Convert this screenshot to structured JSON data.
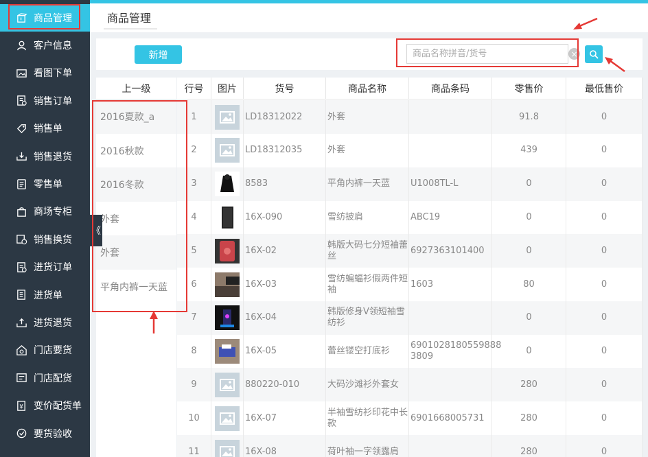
{
  "colors": {
    "accent": "#34c4e4",
    "sidebar": "#2c3844",
    "annotation": "#e53935"
  },
  "sidebar": {
    "items": [
      {
        "label": "商品管理",
        "icon": "box-icon"
      },
      {
        "label": "客户信息",
        "icon": "user-icon"
      },
      {
        "label": "看图下单",
        "icon": "image-order-icon"
      },
      {
        "label": "销售订单",
        "icon": "order-list-icon"
      },
      {
        "label": "销售单",
        "icon": "tag-icon"
      },
      {
        "label": "销售退货",
        "icon": "return-tray-icon"
      },
      {
        "label": "零售单",
        "icon": "receipt-icon"
      },
      {
        "label": "商场专柜",
        "icon": "shopping-bag-icon"
      },
      {
        "label": "销售换货",
        "icon": "exchange-icon"
      },
      {
        "label": "进货订单",
        "icon": "purchase-order-icon"
      },
      {
        "label": "进货单",
        "icon": "purchase-sheet-icon"
      },
      {
        "label": "进货退货",
        "icon": "purchase-return-icon"
      },
      {
        "label": "门店要货",
        "icon": "store-request-icon"
      },
      {
        "label": "门店配货",
        "icon": "store-distribute-icon"
      },
      {
        "label": "变价配货单",
        "icon": "price-change-icon"
      },
      {
        "label": "要货验收",
        "icon": "check-accept-icon"
      }
    ]
  },
  "page": {
    "title": "商品管理"
  },
  "toolbar": {
    "add_label": "新增",
    "search_placeholder": "商品名称拼音/货号"
  },
  "categories": {
    "header": "上一级",
    "items": [
      "2016夏款_a",
      "2016秋款",
      "2016冬款",
      "外套",
      "外套",
      "平角内裤一天蓝"
    ]
  },
  "table": {
    "columns": [
      "行号",
      "图片",
      "货号",
      "商品名称",
      "商品条码",
      "零售价",
      "最低售价"
    ],
    "rows": [
      {
        "no": "1",
        "img": "placeholder",
        "code": "LD18312022",
        "name": "外套",
        "barcode": "",
        "retail": "91.8",
        "min": "0"
      },
      {
        "no": "2",
        "img": "placeholder",
        "code": "LD18312035",
        "name": "外套",
        "barcode": "",
        "retail": "439",
        "min": "0"
      },
      {
        "no": "3",
        "img": "coat-photo",
        "code": "8583",
        "name": "平角内裤一天蓝",
        "barcode": "U1008TL-L",
        "retail": "0",
        "min": "0"
      },
      {
        "no": "4",
        "img": "dark-tile-photo",
        "code": "16X-090",
        "name": "雪纺披肩",
        "barcode": "ABC19",
        "retail": "0",
        "min": "0"
      },
      {
        "no": "5",
        "img": "red-case-photo",
        "code": "16X-02",
        "name": "韩版大码七分短袖蕾丝",
        "barcode": "6927363101400",
        "retail": "0",
        "min": "0"
      },
      {
        "no": "6",
        "img": "desk-photo",
        "code": "16X-03",
        "name": "雪纺蝙蝠衫假两件短袖",
        "barcode": "1603",
        "retail": "80",
        "min": "0"
      },
      {
        "no": "7",
        "img": "night-photo",
        "code": "16X-04",
        "name": "韩版修身V领短袖雪纺衫",
        "barcode": "",
        "retail": "0",
        "min": "0"
      },
      {
        "no": "8",
        "img": "box-photo",
        "code": "16X-05",
        "name": "蕾丝镂空打底衫",
        "barcode": "6901028180559888 3809",
        "retail": "0",
        "min": "0"
      },
      {
        "no": "9",
        "img": "placeholder",
        "code": "880220-010",
        "name": "大码沙滩衫外套女",
        "barcode": "",
        "retail": "280",
        "min": "0"
      },
      {
        "no": "10",
        "img": "placeholder",
        "code": "16X-07",
        "name": "半袖雪纺衫印花中长款",
        "barcode": "6901668005731",
        "retail": "280",
        "min": "0"
      },
      {
        "no": "11",
        "img": "placeholder",
        "code": "16X-08",
        "name": "荷叶袖一字领露肩",
        "barcode": "",
        "retail": "280",
        "min": "0"
      }
    ]
  }
}
